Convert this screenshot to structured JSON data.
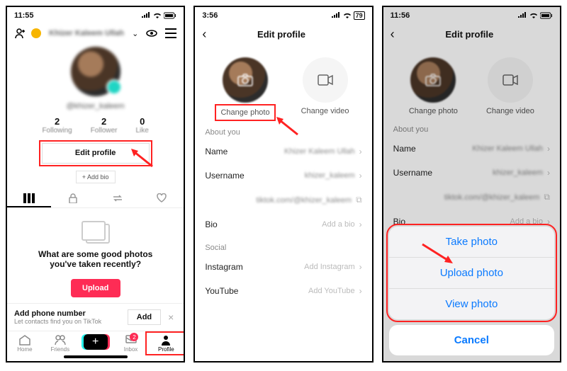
{
  "screen1": {
    "time": "11:55",
    "user_display": "Khizer Kaleem Ullah",
    "handle": "@khizer_kaleem",
    "stats": {
      "following": {
        "n": "2",
        "l": "Following"
      },
      "follower": {
        "n": "2",
        "l": "Follower"
      },
      "like": {
        "n": "0",
        "l": "Like"
      }
    },
    "edit_profile": "Edit profile",
    "add_bio": "+ Add bio",
    "prompt": "What are some good photos you've taken recently?",
    "upload": "Upload",
    "banner": {
      "title": "Add phone number",
      "sub": "Let contacts find you on TikTok",
      "add": "Add"
    },
    "tabs": {
      "home": "Home",
      "friends": "Friends",
      "inbox": "Inbox",
      "profile": "Profile",
      "inbox_badge": "2"
    }
  },
  "screen2": {
    "time": "3:56",
    "title": "Edit profile",
    "change_photo": "Change photo",
    "change_video": "Change video",
    "about_you": "About you",
    "name": {
      "k": "Name",
      "v": "Khizer Kaleem Ullah"
    },
    "username": {
      "k": "Username",
      "v": "khizer_kaleem"
    },
    "link": "tiktok.com/@khizer_kaleem",
    "bio": {
      "k": "Bio",
      "v": "Add a bio"
    },
    "social": "Social",
    "instagram": {
      "k": "Instagram",
      "v": "Add Instagram"
    },
    "youtube": {
      "k": "YouTube",
      "v": "Add YouTube"
    }
  },
  "screen3": {
    "time": "11:56",
    "sheet": {
      "take": "Take photo",
      "upload": "Upload photo",
      "view": "View photo",
      "cancel": "Cancel"
    }
  }
}
